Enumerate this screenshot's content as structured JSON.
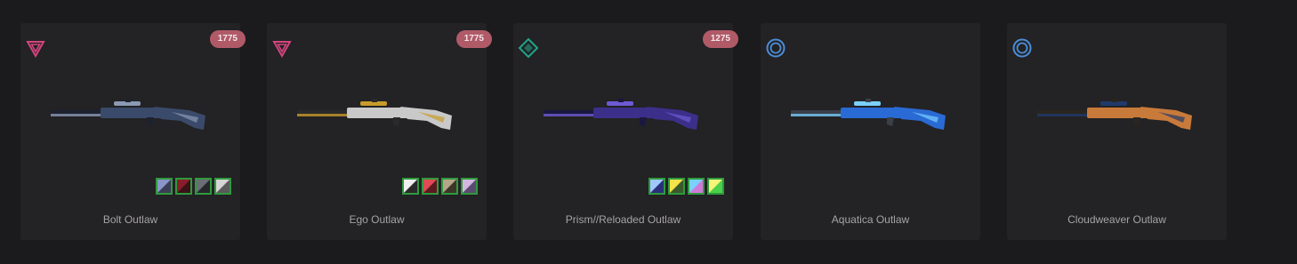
{
  "skins": [
    {
      "name": "Bolt Outlaw",
      "price": "1775",
      "tier_icon": "premium-tier-icon",
      "tier_color": "#d4457f",
      "gun_colors": [
        "#3a4a6a",
        "#8a9ab5",
        "#1d2230"
      ],
      "chromas": [
        [
          "#8a95c8",
          "#3b3d55"
        ],
        [
          "#8a1d2c",
          "#3a1218"
        ],
        [
          "#6a6d75",
          "#25272b"
        ],
        [
          "#d6d6d6",
          "#5a5a5a"
        ]
      ]
    },
    {
      "name": "Ego Outlaw",
      "price": "1775",
      "tier_icon": "premium-tier-icon",
      "tier_color": "#d4457f",
      "gun_colors": [
        "#c9c9c9",
        "#c89b2a",
        "#2a2a2a"
      ],
      "chromas": [
        [
          "#f0f0f0",
          "#2a2a2a"
        ],
        [
          "#e04a55",
          "#5a1a20"
        ],
        [
          "#b5a58a",
          "#3d3528"
        ],
        [
          "#d2b8e0",
          "#5a4a70"
        ]
      ]
    },
    {
      "name": "Prism//Reloaded Outlaw",
      "price": "1275",
      "tier_icon": "select-tier-icon",
      "tier_color": "#1fa58a",
      "gun_colors": [
        "#3c2f8a",
        "#6e5ad4",
        "#1a1840"
      ],
      "chromas": [
        [
          "#a0c8ff",
          "#2a2f7a"
        ],
        [
          "#f5e34a",
          "#3a5a2a"
        ],
        [
          "#7ad0ff",
          "#d07ad8"
        ],
        [
          "#f5f57a",
          "#4ad04a"
        ]
      ]
    },
    {
      "name": "Aquatica Outlaw",
      "price": "",
      "tier_icon": "deluxe-tier-icon",
      "tier_color": "#4a8ed8",
      "gun_colors": [
        "#2a6ad4",
        "#7ad0ff",
        "#3a3f48"
      ],
      "chromas": []
    },
    {
      "name": "Cloudweaver Outlaw",
      "price": "",
      "tier_icon": "deluxe-tier-icon",
      "tier_color": "#4a8ed8",
      "gun_colors": [
        "#c87a3a",
        "#1f3a6a",
        "#2a2520"
      ],
      "chromas": []
    }
  ]
}
